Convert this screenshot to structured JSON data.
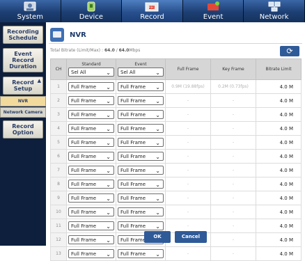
{
  "nav": {
    "tabs": [
      {
        "label": "System",
        "icon": "system-icon"
      },
      {
        "label": "Device",
        "icon": "device-icon"
      },
      {
        "label": "Record",
        "icon": "record-icon",
        "active": true
      },
      {
        "label": "Event",
        "icon": "event-icon"
      },
      {
        "label": "Network",
        "icon": "network-icon"
      }
    ]
  },
  "sidebar": {
    "items": [
      {
        "label": "Recording Schedule"
      },
      {
        "label": "Event Record Duration"
      },
      {
        "label": "Record Setup"
      },
      {
        "label": "NVR"
      },
      {
        "label": "Network Camera"
      },
      {
        "label": "Record Option"
      }
    ]
  },
  "main": {
    "title": "NVR",
    "bitrate_label": "Total Bitrate (Limit/Max) : ",
    "bitrate_limit": "64.0",
    "bitrate_sep": " / ",
    "bitrate_max": "64.0",
    "bitrate_unit": "Mbps",
    "refresh_icon": "refresh-icon",
    "columns": [
      "CH",
      "Standard",
      "Event",
      "Full Frame",
      "Key Frame",
      "Bitrate Limit"
    ],
    "header_select": "Sel All",
    "rows": [
      {
        "ch": "1",
        "standard": "Full Frame",
        "event": "Full Frame",
        "full_frame": "0.9M (19.88fps)",
        "key_frame": "0.2M (0.73fps)",
        "bitrate": "4.0 M"
      },
      {
        "ch": "2",
        "standard": "Full Frame",
        "event": "Full Frame",
        "full_frame": "-",
        "key_frame": "-",
        "bitrate": "4.0 M"
      },
      {
        "ch": "3",
        "standard": "Full Frame",
        "event": "Full Frame",
        "full_frame": "-",
        "key_frame": "-",
        "bitrate": "4.0 M"
      },
      {
        "ch": "4",
        "standard": "Full Frame",
        "event": "Full Frame",
        "full_frame": "-",
        "key_frame": "-",
        "bitrate": "4.0 M"
      },
      {
        "ch": "5",
        "standard": "Full Frame",
        "event": "Full Frame",
        "full_frame": "-",
        "key_frame": "-",
        "bitrate": "4.0 M"
      },
      {
        "ch": "6",
        "standard": "Full Frame",
        "event": "Full Frame",
        "full_frame": "-",
        "key_frame": "-",
        "bitrate": "4.0 M"
      },
      {
        "ch": "7",
        "standard": "Full Frame",
        "event": "Full Frame",
        "full_frame": "-",
        "key_frame": "-",
        "bitrate": "4.0 M"
      },
      {
        "ch": "8",
        "standard": "Full Frame",
        "event": "Full Frame",
        "full_frame": "-",
        "key_frame": "-",
        "bitrate": "4.0 M"
      },
      {
        "ch": "9",
        "standard": "Full Frame",
        "event": "Full Frame",
        "full_frame": "-",
        "key_frame": "-",
        "bitrate": "4.0 M"
      },
      {
        "ch": "10",
        "standard": "Full Frame",
        "event": "Full Frame",
        "full_frame": "-",
        "key_frame": "-",
        "bitrate": "4.0 M"
      },
      {
        "ch": "11",
        "standard": "Full Frame",
        "event": "Full Frame",
        "full_frame": "-",
        "key_frame": "-",
        "bitrate": "4.0 M"
      },
      {
        "ch": "12",
        "standard": "Full Frame",
        "event": "Full Frame",
        "full_frame": "-",
        "key_frame": "-",
        "bitrate": "4.0 M"
      },
      {
        "ch": "13",
        "standard": "Full Frame",
        "event": "Full Frame",
        "full_frame": "-",
        "key_frame": "-",
        "bitrate": "4.0 M"
      }
    ]
  },
  "buttons": {
    "ok": "OK",
    "cancel": "Cancel"
  }
}
